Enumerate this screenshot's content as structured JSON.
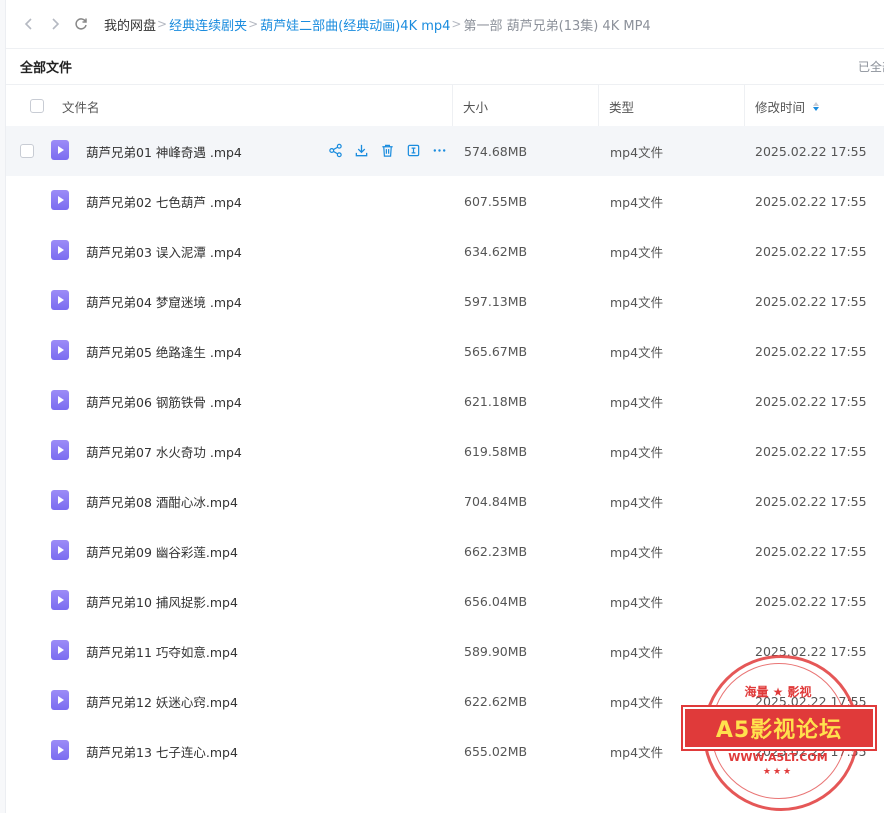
{
  "nav": {
    "back_icon": "chevron-left-icon",
    "forward_icon": "chevron-right-icon",
    "refresh_icon": "refresh-icon",
    "breadcrumbs": [
      {
        "label": "我的网盘",
        "style": "root"
      },
      {
        "label": "经典连续剧夹",
        "style": "link"
      },
      {
        "label": "葫芦娃二部曲(经典动画)4K mp4",
        "style": "link"
      },
      {
        "label": "第一部 葫芦兄弟(13集) 4K MP4",
        "style": "current"
      }
    ],
    "separator": ">"
  },
  "section": {
    "title": "全部文件",
    "loaded_text": "已全部"
  },
  "table": {
    "headers": {
      "name": "文件名",
      "size": "大小",
      "type": "类型",
      "modified": "修改时间"
    },
    "rows": [
      {
        "name": "葫芦兄弟01 神峰奇遇 .mp4",
        "size": "574.68MB",
        "type": "mp4文件",
        "modified": "2025.02.22 17:55"
      },
      {
        "name": "葫芦兄弟02 七色葫芦 .mp4",
        "size": "607.55MB",
        "type": "mp4文件",
        "modified": "2025.02.22 17:55"
      },
      {
        "name": "葫芦兄弟03 误入泥潭 .mp4",
        "size": "634.62MB",
        "type": "mp4文件",
        "modified": "2025.02.22 17:55"
      },
      {
        "name": "葫芦兄弟04 梦窟迷境 .mp4",
        "size": "597.13MB",
        "type": "mp4文件",
        "modified": "2025.02.22 17:55"
      },
      {
        "name": "葫芦兄弟05 绝路逢生 .mp4",
        "size": "565.67MB",
        "type": "mp4文件",
        "modified": "2025.02.22 17:55"
      },
      {
        "name": "葫芦兄弟06 钢筋铁骨 .mp4",
        "size": "621.18MB",
        "type": "mp4文件",
        "modified": "2025.02.22 17:55"
      },
      {
        "name": "葫芦兄弟07 水火奇功 .mp4",
        "size": "619.58MB",
        "type": "mp4文件",
        "modified": "2025.02.22 17:55"
      },
      {
        "name": "葫芦兄弟08 酒酣心冰.mp4",
        "size": "704.84MB",
        "type": "mp4文件",
        "modified": "2025.02.22 17:55"
      },
      {
        "name": "葫芦兄弟09 幽谷彩莲.mp4",
        "size": "662.23MB",
        "type": "mp4文件",
        "modified": "2025.02.22 17:55"
      },
      {
        "name": "葫芦兄弟10 捕风捉影.mp4",
        "size": "656.04MB",
        "type": "mp4文件",
        "modified": "2025.02.22 17:55"
      },
      {
        "name": "葫芦兄弟11 巧夺如意.mp4",
        "size": "589.90MB",
        "type": "mp4文件",
        "modified": "2025.02.22 17:55"
      },
      {
        "name": "葫芦兄弟12 妖迷心窍.mp4",
        "size": "622.62MB",
        "type": "mp4文件",
        "modified": "2025.02.22 17:55"
      },
      {
        "name": "葫芦兄弟13 七子连心.mp4",
        "size": "655.02MB",
        "type": "mp4文件",
        "modified": "2025.02.22 17:55"
      }
    ],
    "row_actions": [
      "share-icon",
      "download-icon",
      "delete-icon",
      "details-icon",
      "more-icon"
    ],
    "file_icon": "video-file-icon",
    "sort_icon": "sort-icon"
  },
  "watermark": {
    "top_text": "海量 ★ 影视",
    "banner_text": "A5影视论坛",
    "url_text": "WWW.A5LT.COM",
    "stars": "★★★"
  },
  "colors": {
    "accent": "#1a8cde",
    "file_icon": "#8b7cf5",
    "stamp": "#e03a3a",
    "hover_row": "#f4f6f9"
  }
}
